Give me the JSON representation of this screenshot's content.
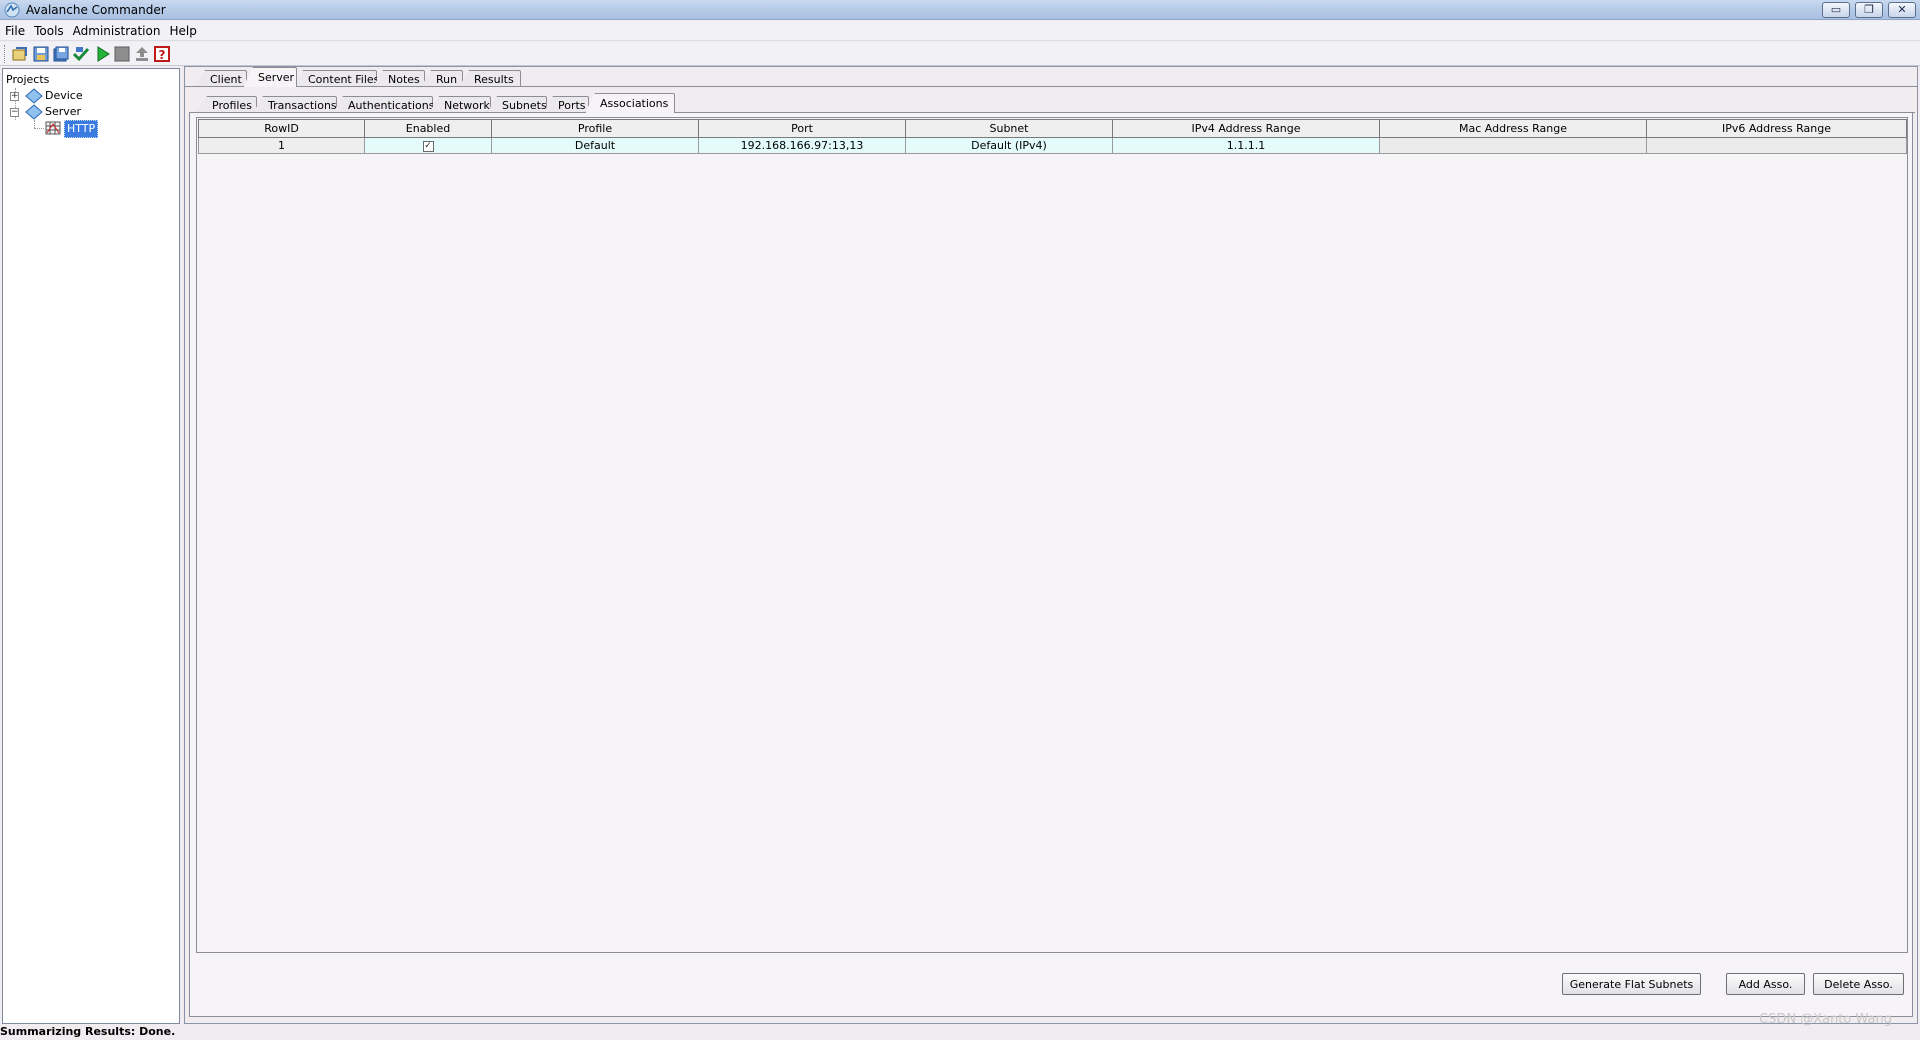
{
  "window": {
    "title": "Avalanche Commander",
    "controls": {
      "minimize": "▭",
      "restore": "❐",
      "close": "✕"
    }
  },
  "menu": [
    "File",
    "Tools",
    "Administration",
    "Help"
  ],
  "toolbar": {
    "icons": [
      "open-project-icon",
      "save-icon",
      "save-all-icon",
      "check-icon",
      "run-icon",
      "stop-icon",
      "upload-icon",
      "help-icon"
    ]
  },
  "tree": {
    "root": "Projects",
    "items": [
      {
        "label": "Device",
        "expander": "+"
      },
      {
        "label": "Server",
        "expander": "−"
      },
      {
        "label": "HTTP"
      }
    ]
  },
  "tabs_outer": [
    "Client",
    "Server",
    "Content Files",
    "Notes",
    "Run",
    "Results"
  ],
  "tabs_outer_active": "Server",
  "tabs_inner": [
    "Profiles",
    "Transactions",
    "Authentications",
    "Network",
    "Subnets",
    "Ports",
    "Associations"
  ],
  "tabs_inner_active": "Associations",
  "table": {
    "columns": [
      "RowID",
      "Enabled",
      "Profile",
      "Port",
      "Subnet",
      "IPv4 Address Range",
      "Mac Address Range",
      "IPv6 Address Range"
    ],
    "rows": [
      {
        "rowid": "1",
        "enabled": "✓",
        "profile": "Default",
        "port": "192.168.166.97:13,13",
        "subnet": "Default  (IPv4)",
        "ipv4": "1.1.1.1",
        "mac": "",
        "ipv6": ""
      }
    ]
  },
  "buttons": {
    "generate": "Generate Flat Subnets",
    "add": "Add Asso.",
    "delete": "Delete Asso."
  },
  "status": "Summarizing Results: Done.",
  "watermark": "CSDN @Xanto Wang"
}
